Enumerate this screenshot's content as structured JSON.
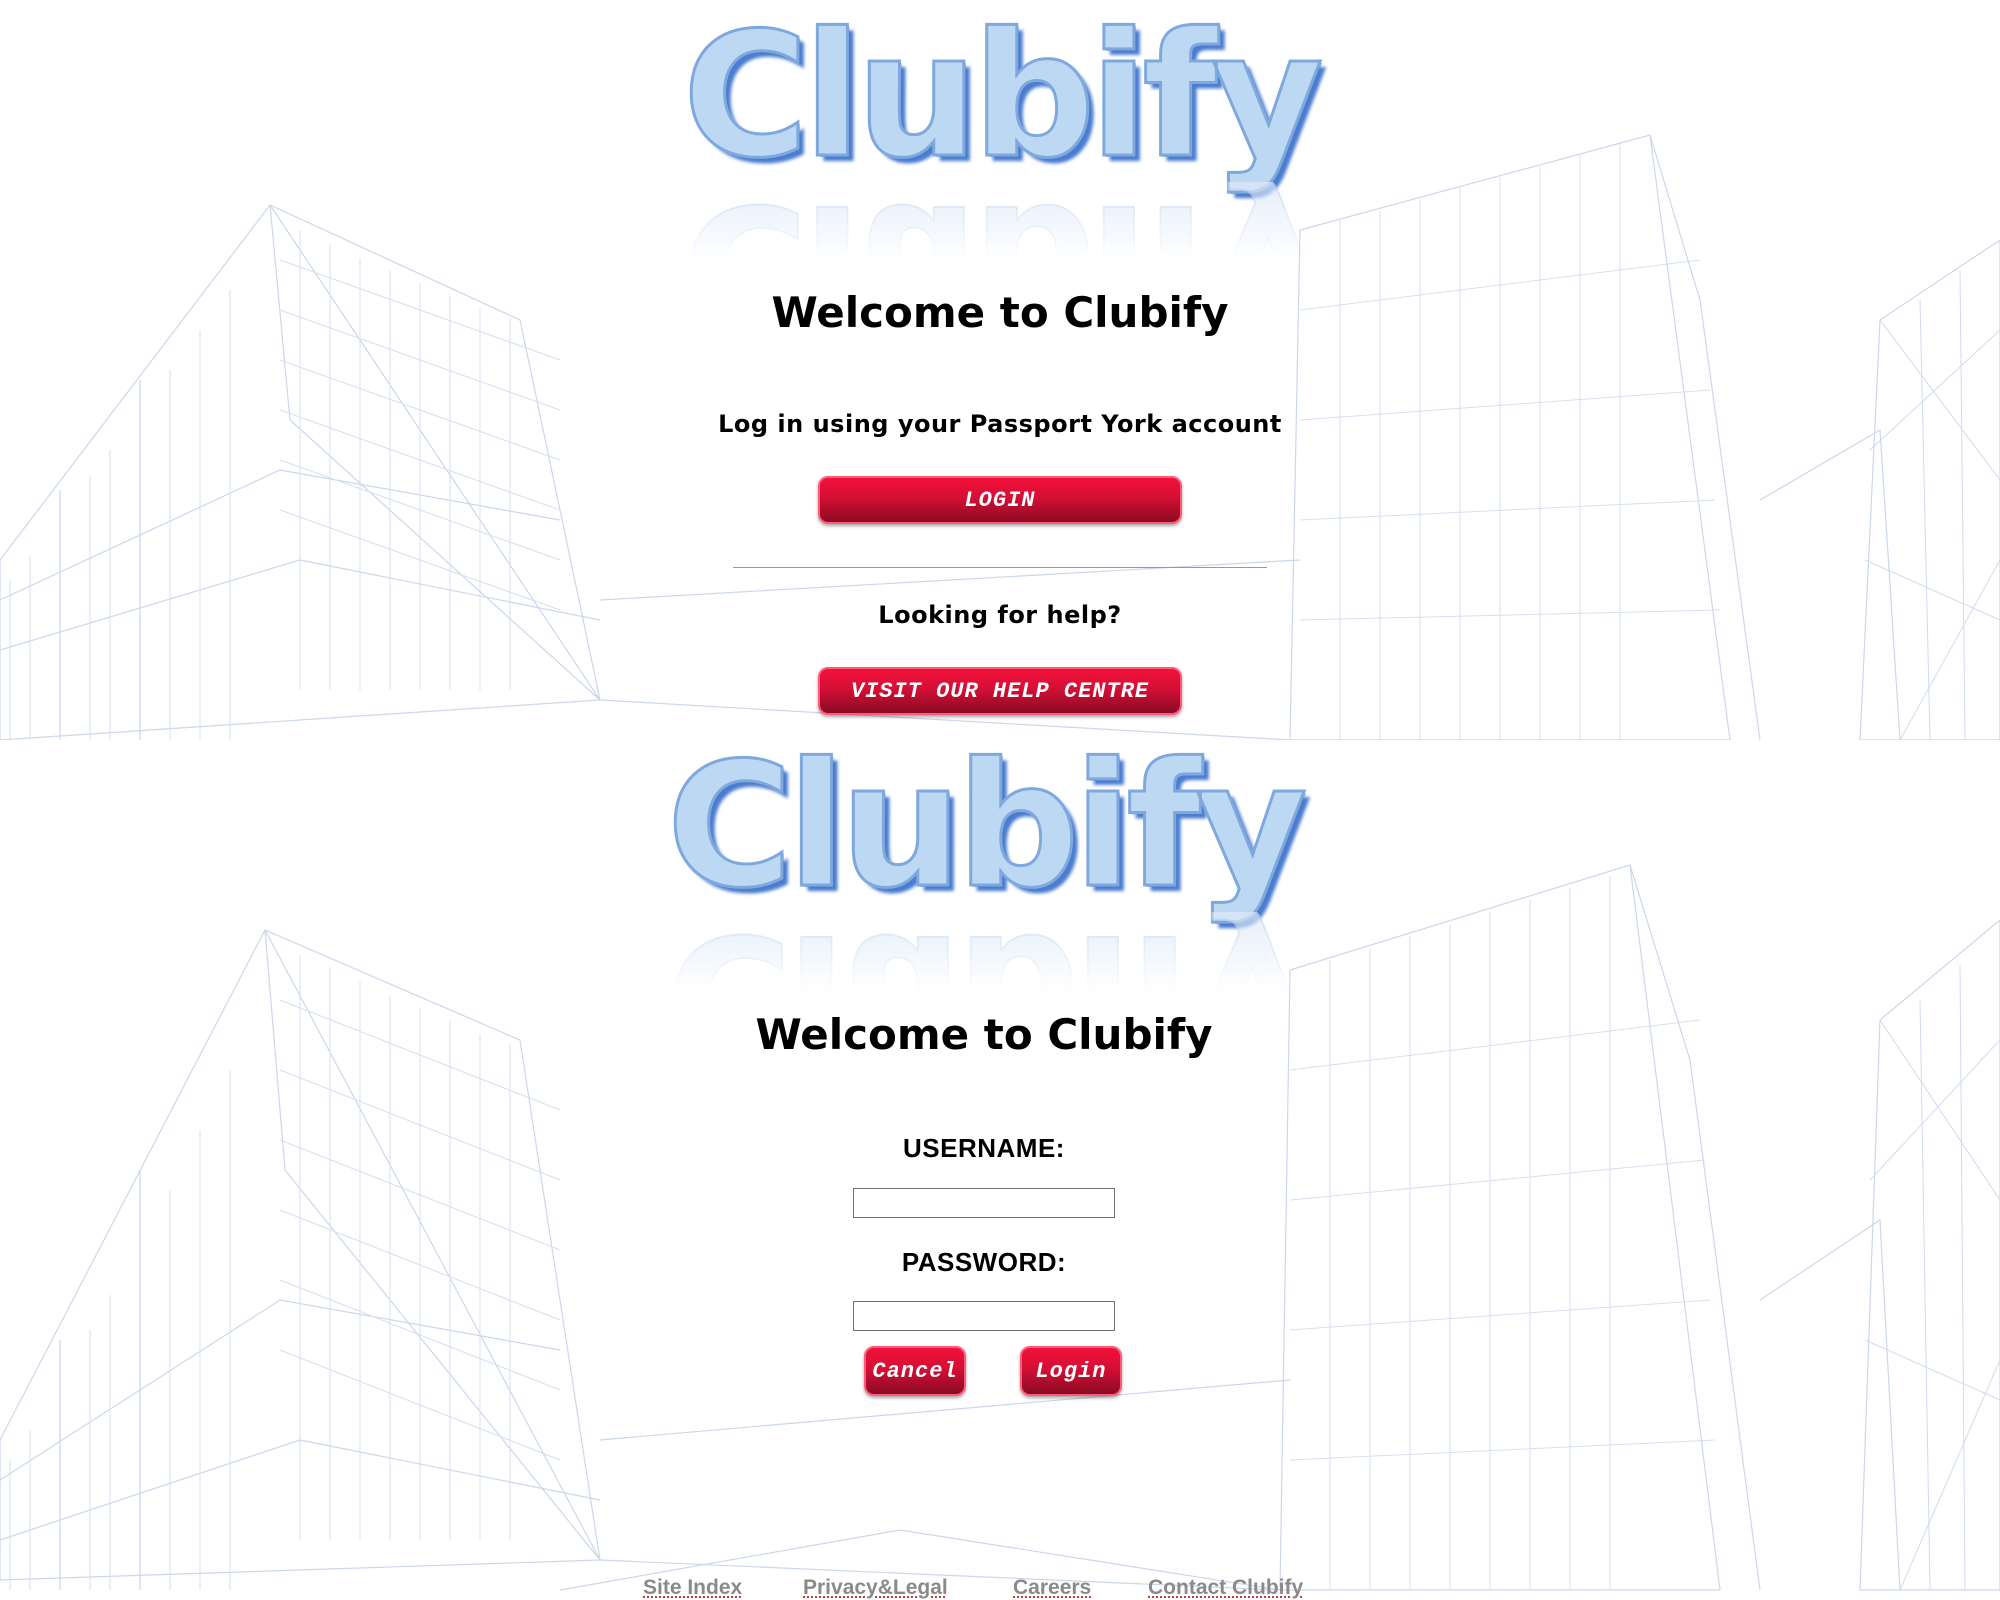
{
  "login_landing": {
    "logo_text": "Clubify",
    "welcome_heading": "Welcome to Clubify",
    "instruction": "Log in using your Passport York account",
    "login_button": "LOGIN",
    "help_prompt": "Looking for help?",
    "help_button": "VISIT OUR HELP CENTRE"
  },
  "login_form": {
    "logo_text": "Clubify",
    "welcome_heading": "Welcome to Clubify",
    "username_label": "USERNAME:",
    "username_value": "",
    "password_label": "PASSWORD:",
    "password_value": "",
    "cancel_button": "Cancel",
    "login_button": "Login"
  },
  "footer": {
    "links": [
      "Site Index",
      "Privacy&Legal",
      "Careers",
      "Contact Clubify"
    ]
  },
  "colors": {
    "button_red": "#d40f35",
    "logo_blue": "#bdd8f3",
    "sketch_lines": "#c9d6ec"
  }
}
